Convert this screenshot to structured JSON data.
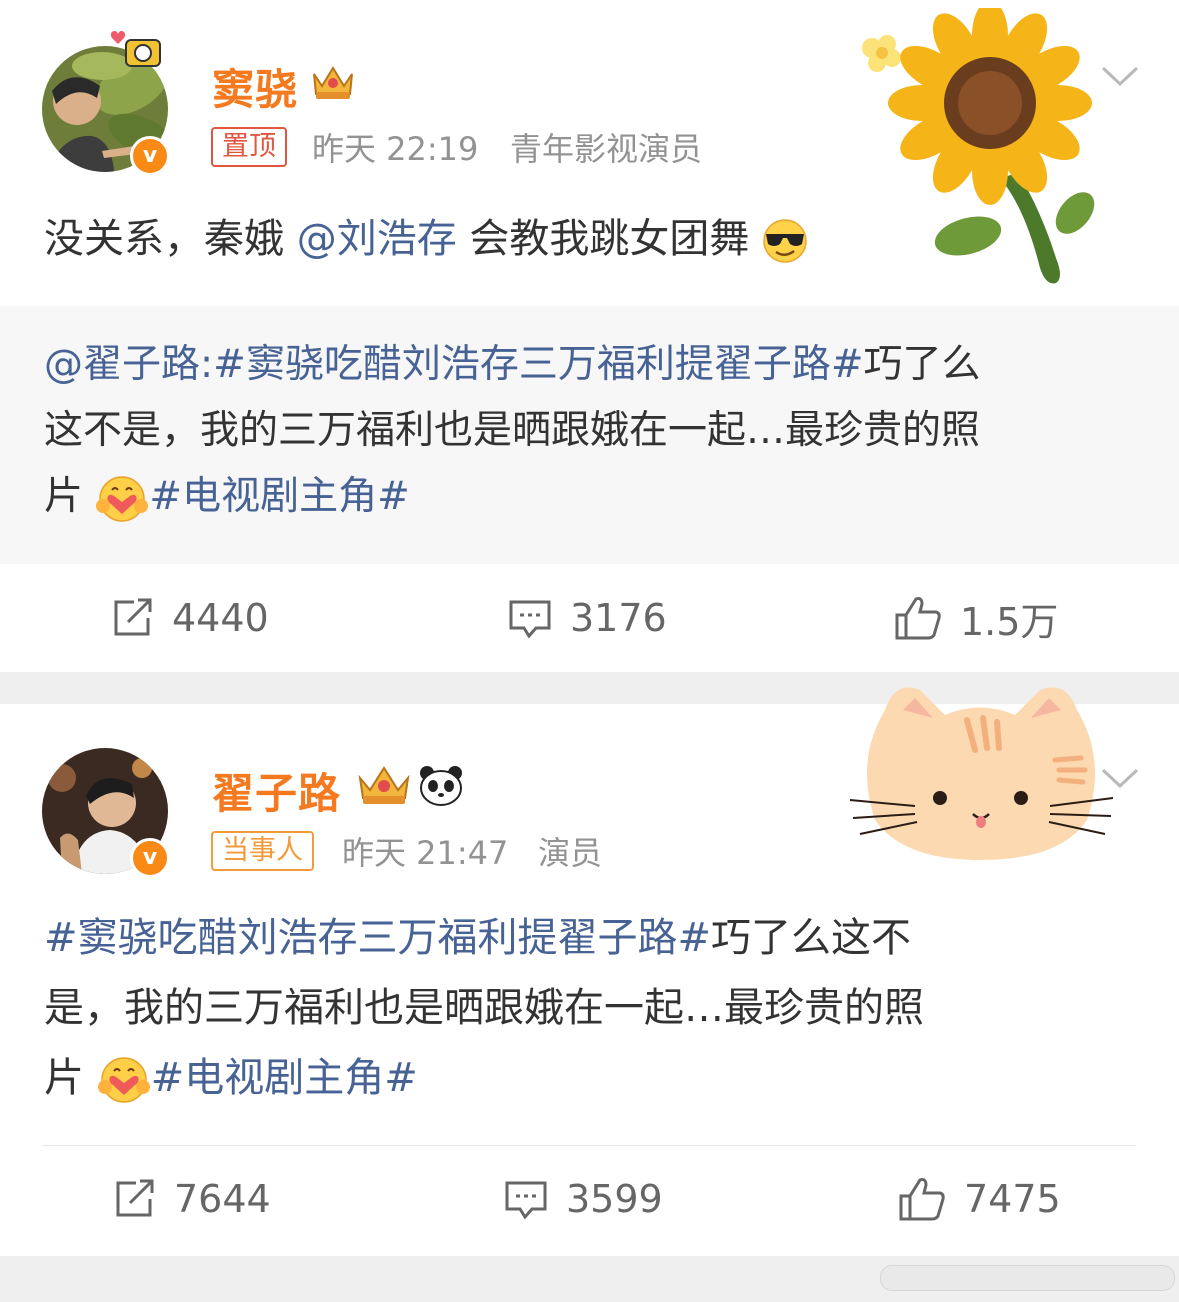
{
  "post1": {
    "username": "窦骁",
    "tag": "置顶",
    "time": "昨天 22:19",
    "user_title": "青年影视演员",
    "content": {
      "before": "没关系，秦娥",
      "mention": "@刘浩存",
      "after": " 会教我跳女团舞"
    },
    "repost": {
      "author": "@翟子路:",
      "hashtag": "#窦骁吃醋刘浩存三万福利提翟子路#",
      "line1_rest": "巧了么",
      "line2": "这不是，我的三万福利也是晒跟娥在一起…最珍贵的照",
      "line3_start": "片",
      "hashtag2": "#电视剧主角#"
    },
    "actions": {
      "repost_count": "4440",
      "comment_count": "3176",
      "like_count": "1.5万"
    }
  },
  "post2": {
    "username": "翟子路",
    "tag": "当事人",
    "time": "昨天 21:47",
    "user_title": "演员",
    "content": {
      "hashtag": "#窦骁吃醋刘浩存三万福利提翟子路#",
      "line1_rest": "巧了么这不",
      "line2": "是，我的三万福利也是晒跟娥在一起…最珍贵的照",
      "line3_start": "片",
      "hashtag2": "#电视剧主角#"
    },
    "actions": {
      "repost_count": "7644",
      "comment_count": "3599",
      "like_count": "7475"
    }
  },
  "colors": {
    "username": "#f4791f",
    "link": "#476294",
    "tag_pinned": "#e2563f",
    "tag_involved": "#f39a3a",
    "meta": "#939393",
    "verified_badge": "#f98a16"
  },
  "icons": [
    "repost-icon",
    "comment-icon",
    "like-icon",
    "chevron-down-icon",
    "crown-icon",
    "panda-icon",
    "sunglasses-emoji-icon",
    "hug-emoji-icon",
    "verified-icon",
    "sunflower-sticker",
    "cat-sticker"
  ]
}
